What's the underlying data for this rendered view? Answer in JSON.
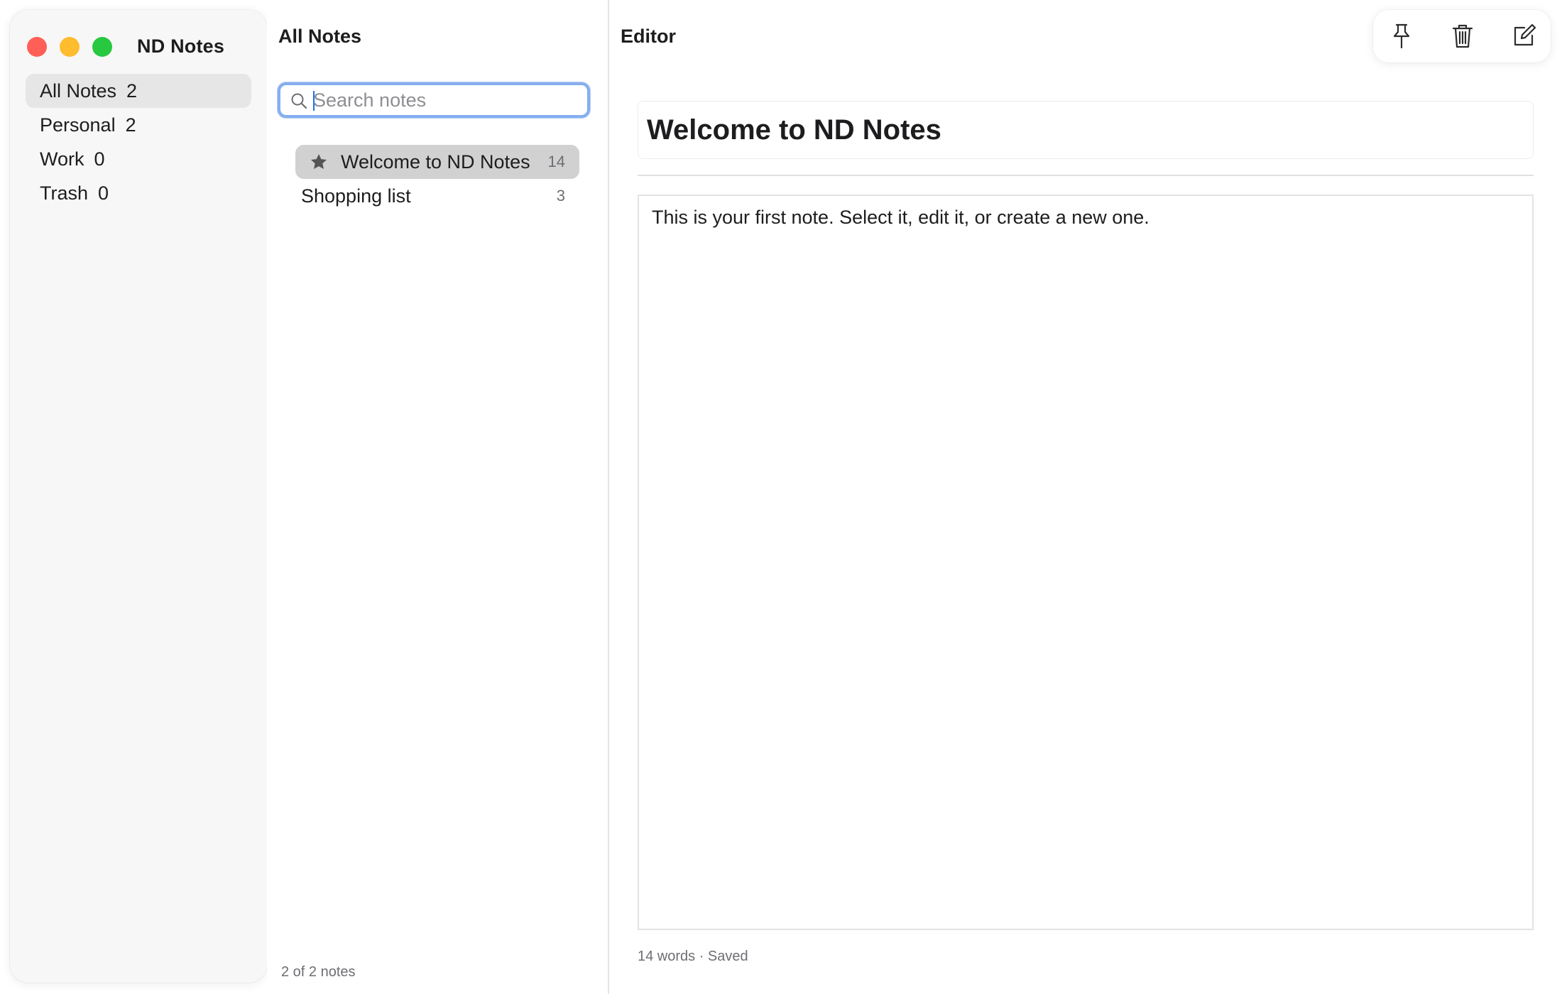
{
  "app": {
    "title": "ND Notes",
    "traffic_colors": {
      "close": "#ff5f57",
      "minimize": "#febc2e",
      "zoom": "#28c840"
    }
  },
  "sidebar": {
    "items": [
      {
        "label": "All Notes",
        "count": "2",
        "active": true
      },
      {
        "label": "Personal",
        "count": "2",
        "active": false
      },
      {
        "label": "Work",
        "count": "0",
        "active": false
      },
      {
        "label": "Trash",
        "count": "0",
        "active": false
      }
    ]
  },
  "list": {
    "title": "All Notes",
    "search_placeholder": "Search notes",
    "search_value": "",
    "notes": [
      {
        "title": "Welcome to ND Notes",
        "word_count": "14",
        "pinned": true,
        "selected": true,
        "icon": "star-icon"
      },
      {
        "title": "Shopping list",
        "word_count": "3",
        "pinned": false,
        "selected": false
      }
    ],
    "footer": "2 of 2 notes"
  },
  "editor": {
    "label": "Editor",
    "toolbar": {
      "pin_icon": "pin-icon",
      "delete_icon": "trash-icon",
      "new_icon": "compose-icon"
    },
    "note_title": "Welcome to ND Notes",
    "note_body": "This is your first note. Select it, edit it, or create a new one.",
    "status": "14 words · Saved"
  },
  "colors": {
    "accent": "#86aef0",
    "selection": "#d1d1d1",
    "sidebar_active": "#e6e6e6"
  }
}
